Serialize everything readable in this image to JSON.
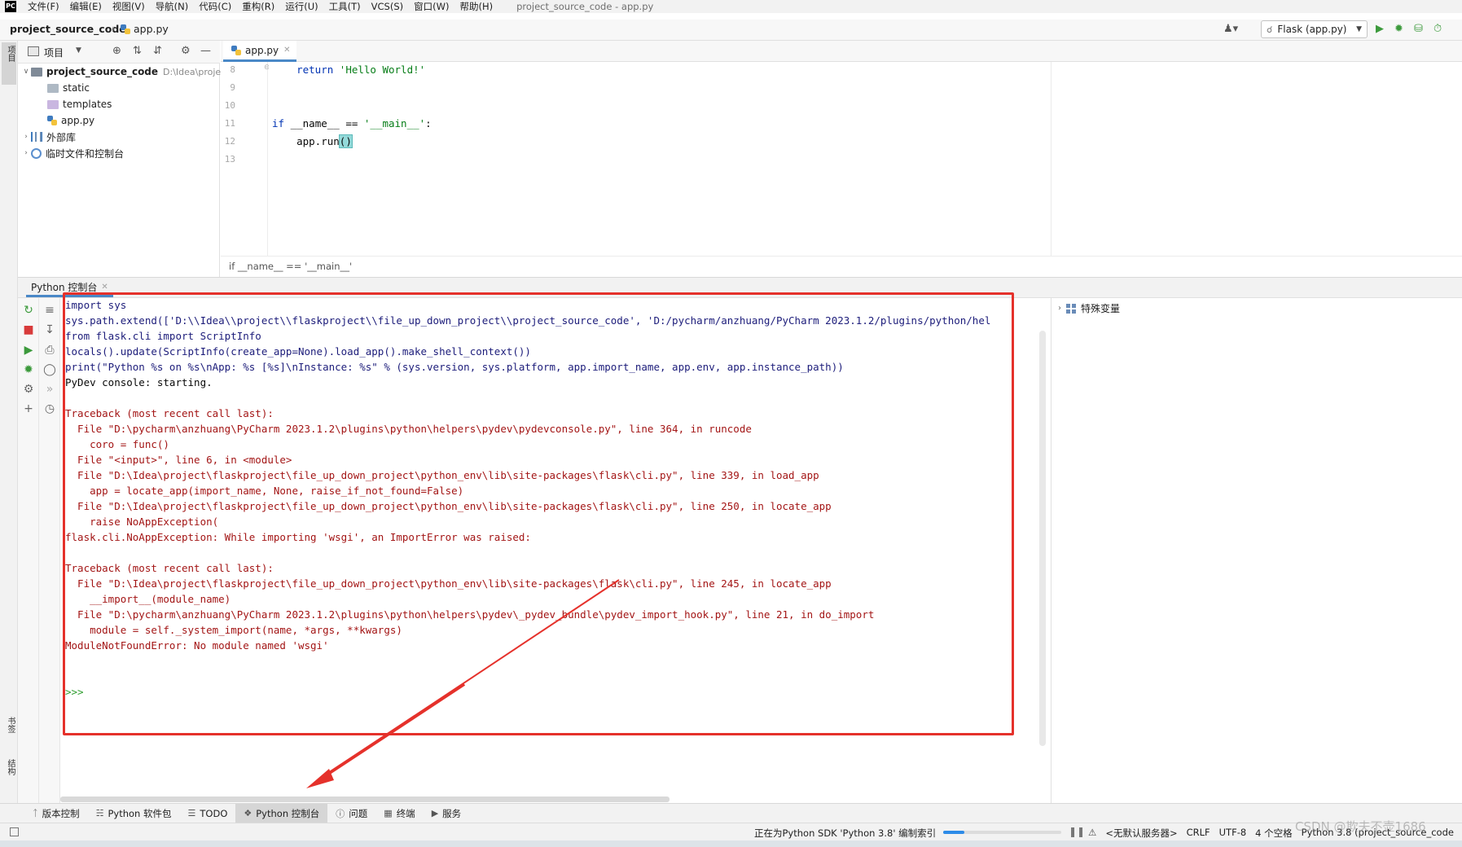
{
  "menubar": {
    "logo": "PC",
    "items": [
      "文件(F)",
      "编辑(E)",
      "视图(V)",
      "导航(N)",
      "代码(C)",
      "重构(R)",
      "运行(U)",
      "工具(T)",
      "VCS(S)",
      "窗口(W)",
      "帮助(H)"
    ],
    "window_title": "project_source_code - app.py"
  },
  "navbar": {
    "project": "project_source_code",
    "file": "app.py",
    "run_config": "Flask (app.py)"
  },
  "left_strip": {
    "project_tab": "项目",
    "bookmarks_tab": "书签",
    "structure_tab": "结构"
  },
  "project_panel": {
    "title": "项目",
    "tree": {
      "root_name": "project_source_code",
      "root_path": "D:\\Idea\\proje",
      "static": "static",
      "templates": "templates",
      "app": "app.py",
      "external_libs": "外部库",
      "scratches": "临时文件和控制台"
    }
  },
  "editor": {
    "tab": "app.py",
    "lines": [
      "8",
      "9",
      "10",
      "11",
      "12",
      "13"
    ],
    "code": {
      "l8_kw": "return",
      "l8_str": "'Hello World!'",
      "l11_kw": "if",
      "l11_a": "__name__ == ",
      "l11_str": "'__main__'",
      "l11_b": ":",
      "l12_a": "app.run",
      "l12_paren": "()"
    },
    "breadcrumb": "if __name__ == '__main__'"
  },
  "console": {
    "tab": "Python 控制台",
    "lines": {
      "l1": "import sys",
      "l2": "sys.path.extend(['D:\\\\Idea\\\\project\\\\flaskproject\\\\file_up_down_project\\\\project_source_code', 'D:/pycharm/anzhuang/PyCharm 2023.1.2/plugins/python/hel",
      "l3": "from flask.cli import ScriptInfo",
      "l4": "locals().update(ScriptInfo(create_app=None).load_app().make_shell_context())",
      "l5": "print(\"Python %s on %s\\nApp: %s [%s]\\nInstance: %s\" % (sys.version, sys.platform, app.import_name, app.env, app.instance_path))",
      "l6": "PyDev console: starting.",
      "e1": "Traceback (most recent call last):",
      "e2": "  File \"D:\\pycharm\\anzhuang\\PyCharm 2023.1.2\\plugins\\python\\helpers\\pydev\\pydevconsole.py\", line 364, in runcode",
      "e3": "    coro = func()",
      "e4": "  File \"<input>\", line 6, in <module>",
      "e5": "  File \"D:\\Idea\\project\\flaskproject\\file_up_down_project\\python_env\\lib\\site-packages\\flask\\cli.py\", line 339, in load_app",
      "e6": "    app = locate_app(import_name, None, raise_if_not_found=False)",
      "e7": "  File \"D:\\Idea\\project\\flaskproject\\file_up_down_project\\python_env\\lib\\site-packages\\flask\\cli.py\", line 250, in locate_app",
      "e8": "    raise NoAppException(",
      "e9": "flask.cli.NoAppException: While importing 'wsgi', an ImportError was raised:",
      "f1": "Traceback (most recent call last):",
      "f2": "  File \"D:\\Idea\\project\\flaskproject\\file_up_down_project\\python_env\\lib\\site-packages\\flask\\cli.py\", line 245, in locate_app",
      "f3": "    __import__(module_name)",
      "f4": "  File \"D:\\pycharm\\anzhuang\\PyCharm 2023.1.2\\plugins\\python\\helpers\\pydev\\_pydev_bundle\\pydev_import_hook.py\", line 21, in do_import",
      "f5": "    module = self._system_import(name, *args, **kwargs)",
      "f6": "ModuleNotFoundError: No module named 'wsgi'",
      "prompt": ">>>"
    }
  },
  "variables": {
    "special": "特殊变量"
  },
  "bottom_tools": [
    "版本控制",
    "Python 软件包",
    "TODO",
    "Python 控制台",
    "问题",
    "终端",
    "服务"
  ],
  "statusbar": {
    "progress_text": "正在为Python SDK 'Python 3.8' 编制索引",
    "progress_fraction": 0.18,
    "server": "<无默认服务器>",
    "line_sep": "CRLF",
    "encoding": "UTF-8",
    "indent": "4 个空格",
    "interpreter": "Python 3.8 (project_source_code"
  },
  "watermark": "CSDN @欺夫不壶1686",
  "colors": {
    "highlight_box": "#e5312b",
    "accent": "#4a88c7",
    "error_text": "#a31515",
    "keyword": "#0033b3",
    "string": "#067d17"
  }
}
